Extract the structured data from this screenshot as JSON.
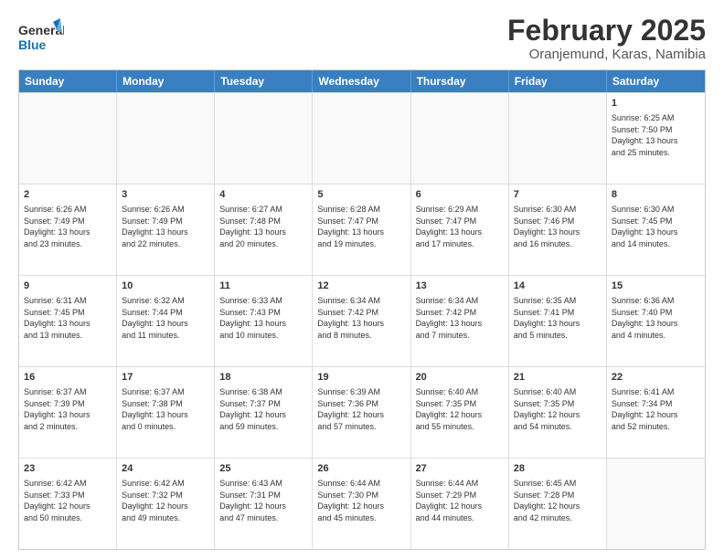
{
  "logo": {
    "line1": "General",
    "line2": "Blue"
  },
  "title": "February 2025",
  "subtitle": "Oranjemund, Karas, Namibia",
  "days": [
    "Sunday",
    "Monday",
    "Tuesday",
    "Wednesday",
    "Thursday",
    "Friday",
    "Saturday"
  ],
  "weeks": [
    [
      {
        "day": "",
        "info": ""
      },
      {
        "day": "",
        "info": ""
      },
      {
        "day": "",
        "info": ""
      },
      {
        "day": "",
        "info": ""
      },
      {
        "day": "",
        "info": ""
      },
      {
        "day": "",
        "info": ""
      },
      {
        "day": "1",
        "info": "Sunrise: 6:25 AM\nSunset: 7:50 PM\nDaylight: 13 hours\nand 25 minutes."
      }
    ],
    [
      {
        "day": "2",
        "info": "Sunrise: 6:26 AM\nSunset: 7:49 PM\nDaylight: 13 hours\nand 23 minutes."
      },
      {
        "day": "3",
        "info": "Sunrise: 6:26 AM\nSunset: 7:49 PM\nDaylight: 13 hours\nand 22 minutes."
      },
      {
        "day": "4",
        "info": "Sunrise: 6:27 AM\nSunset: 7:48 PM\nDaylight: 13 hours\nand 20 minutes."
      },
      {
        "day": "5",
        "info": "Sunrise: 6:28 AM\nSunset: 7:47 PM\nDaylight: 13 hours\nand 19 minutes."
      },
      {
        "day": "6",
        "info": "Sunrise: 6:29 AM\nSunset: 7:47 PM\nDaylight: 13 hours\nand 17 minutes."
      },
      {
        "day": "7",
        "info": "Sunrise: 6:30 AM\nSunset: 7:46 PM\nDaylight: 13 hours\nand 16 minutes."
      },
      {
        "day": "8",
        "info": "Sunrise: 6:30 AM\nSunset: 7:45 PM\nDaylight: 13 hours\nand 14 minutes."
      }
    ],
    [
      {
        "day": "9",
        "info": "Sunrise: 6:31 AM\nSunset: 7:45 PM\nDaylight: 13 hours\nand 13 minutes."
      },
      {
        "day": "10",
        "info": "Sunrise: 6:32 AM\nSunset: 7:44 PM\nDaylight: 13 hours\nand 11 minutes."
      },
      {
        "day": "11",
        "info": "Sunrise: 6:33 AM\nSunset: 7:43 PM\nDaylight: 13 hours\nand 10 minutes."
      },
      {
        "day": "12",
        "info": "Sunrise: 6:34 AM\nSunset: 7:42 PM\nDaylight: 13 hours\nand 8 minutes."
      },
      {
        "day": "13",
        "info": "Sunrise: 6:34 AM\nSunset: 7:42 PM\nDaylight: 13 hours\nand 7 minutes."
      },
      {
        "day": "14",
        "info": "Sunrise: 6:35 AM\nSunset: 7:41 PM\nDaylight: 13 hours\nand 5 minutes."
      },
      {
        "day": "15",
        "info": "Sunrise: 6:36 AM\nSunset: 7:40 PM\nDaylight: 13 hours\nand 4 minutes."
      }
    ],
    [
      {
        "day": "16",
        "info": "Sunrise: 6:37 AM\nSunset: 7:39 PM\nDaylight: 13 hours\nand 2 minutes."
      },
      {
        "day": "17",
        "info": "Sunrise: 6:37 AM\nSunset: 7:38 PM\nDaylight: 13 hours\nand 0 minutes."
      },
      {
        "day": "18",
        "info": "Sunrise: 6:38 AM\nSunset: 7:37 PM\nDaylight: 12 hours\nand 59 minutes."
      },
      {
        "day": "19",
        "info": "Sunrise: 6:39 AM\nSunset: 7:36 PM\nDaylight: 12 hours\nand 57 minutes."
      },
      {
        "day": "20",
        "info": "Sunrise: 6:40 AM\nSunset: 7:35 PM\nDaylight: 12 hours\nand 55 minutes."
      },
      {
        "day": "21",
        "info": "Sunrise: 6:40 AM\nSunset: 7:35 PM\nDaylight: 12 hours\nand 54 minutes."
      },
      {
        "day": "22",
        "info": "Sunrise: 6:41 AM\nSunset: 7:34 PM\nDaylight: 12 hours\nand 52 minutes."
      }
    ],
    [
      {
        "day": "23",
        "info": "Sunrise: 6:42 AM\nSunset: 7:33 PM\nDaylight: 12 hours\nand 50 minutes."
      },
      {
        "day": "24",
        "info": "Sunrise: 6:42 AM\nSunset: 7:32 PM\nDaylight: 12 hours\nand 49 minutes."
      },
      {
        "day": "25",
        "info": "Sunrise: 6:43 AM\nSunset: 7:31 PM\nDaylight: 12 hours\nand 47 minutes."
      },
      {
        "day": "26",
        "info": "Sunrise: 6:44 AM\nSunset: 7:30 PM\nDaylight: 12 hours\nand 45 minutes."
      },
      {
        "day": "27",
        "info": "Sunrise: 6:44 AM\nSunset: 7:29 PM\nDaylight: 12 hours\nand 44 minutes."
      },
      {
        "day": "28",
        "info": "Sunrise: 6:45 AM\nSunset: 7:28 PM\nDaylight: 12 hours\nand 42 minutes."
      },
      {
        "day": "",
        "info": ""
      }
    ]
  ]
}
